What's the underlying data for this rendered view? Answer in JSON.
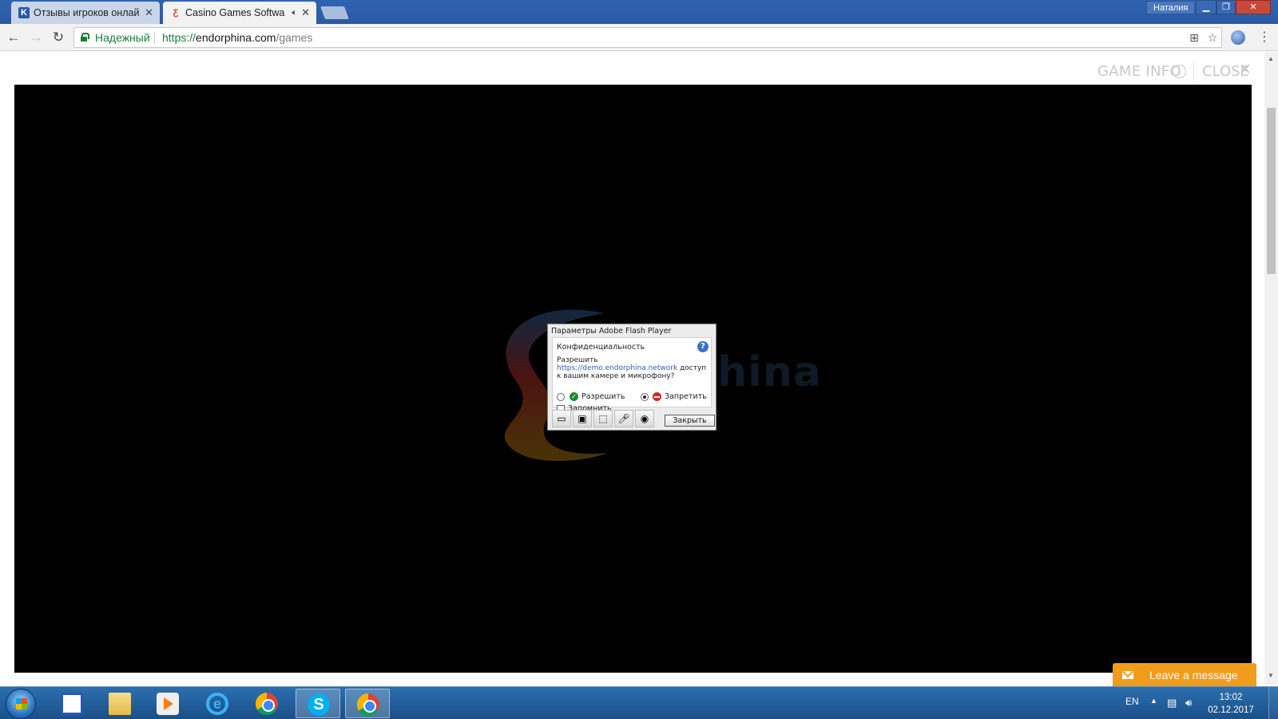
{
  "browser": {
    "tabs": [
      {
        "title": "Отзывы игроков онлай",
        "favicon": "ko-icon",
        "active": false
      },
      {
        "title": "Casino Games Softwa",
        "favicon": "endorphina-icon",
        "active": true,
        "audio": true
      }
    ],
    "profile_name": "Наталия",
    "security_label": "Надежный",
    "url_scheme": "https://",
    "url_host": "endorphina.com",
    "url_path": "/games"
  },
  "page": {
    "game_info_label": "GAME INFO",
    "close_label": "CLOSE",
    "logo_text": "hina"
  },
  "flash_dialog": {
    "title": "Параметры Adobe Flash Player",
    "heading": "Конфиденциальность",
    "question_prefix": "Разрешить",
    "question_link": "https://demo.endorphina.network",
    "question_suffix": " доступ к вашим камере и микрофону?",
    "allow_label": "Разрешить",
    "deny_label": "Запретить",
    "selected": "deny",
    "remember_label": "Запомнить",
    "remember_checked": false,
    "close_button": "Закрыть",
    "tool_icons": [
      "display-icon",
      "privacy-icon",
      "storage-icon",
      "microphone-icon",
      "camera-icon"
    ]
  },
  "chat_widget": {
    "label": "Leave a message",
    "color": "#f19c1a"
  },
  "taskbar": {
    "apps": [
      "floppy-icon",
      "explorer-folder-icon",
      "media-player-icon",
      "internet-explorer-icon",
      "chrome-icon",
      "skype-icon",
      "chrome-icon"
    ],
    "language": "EN",
    "time": "13:02",
    "date": "02.12.2017"
  },
  "colors": {
    "secure_green": "#188038",
    "game_bg": "#000000",
    "link_blue": "#2c5fbf"
  }
}
